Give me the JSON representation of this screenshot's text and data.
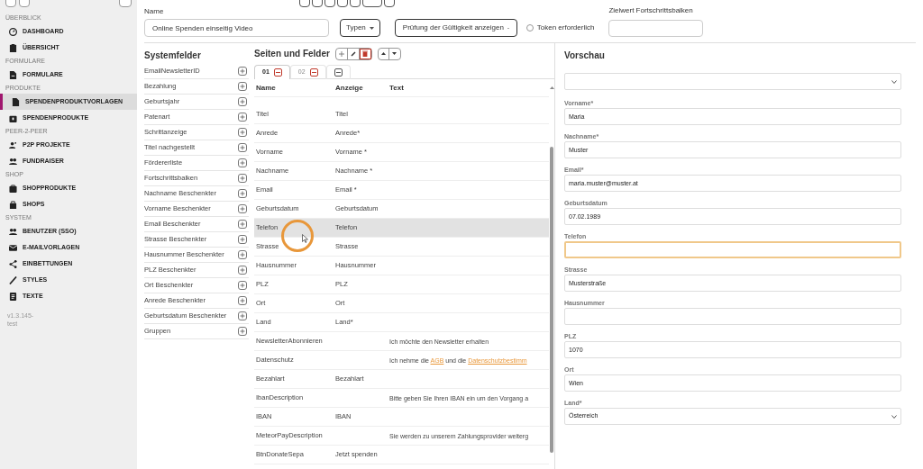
{
  "sidebar": {
    "sections": [
      {
        "title": "ÜBERBLICK",
        "items": [
          {
            "label": "DASHBOARD",
            "selected": false
          },
          {
            "label": "ÜBERSICHT",
            "selected": false
          }
        ]
      },
      {
        "title": "FORMULARE",
        "items": [
          {
            "label": "FORMULARE",
            "selected": false
          }
        ]
      },
      {
        "title": "PRODUKTE",
        "items": [
          {
            "label": "SPENDENPRODUKTVORLAGEN",
            "selected": true
          },
          {
            "label": "SPENDENPRODUKTE",
            "selected": false
          }
        ]
      },
      {
        "title": "PEER-2-PEER",
        "items": [
          {
            "label": "P2P PROJEKTE",
            "selected": false
          },
          {
            "label": "FUNDRAISER",
            "selected": false
          }
        ]
      },
      {
        "title": "SHOP",
        "items": [
          {
            "label": "SHOPPRODUKTE",
            "selected": false
          },
          {
            "label": "SHOPS",
            "selected": false
          }
        ]
      },
      {
        "title": "SYSTEM",
        "items": [
          {
            "label": "BENUTZER (SSO)",
            "selected": false
          },
          {
            "label": "E-MAILVORLAGEN",
            "selected": false
          },
          {
            "label": "EINBETTUNGEN",
            "selected": false
          },
          {
            "label": "STYLES",
            "selected": false
          },
          {
            "label": "TEXTE",
            "selected": false
          }
        ]
      }
    ],
    "version": "v1.3.145-\ntest"
  },
  "form": {
    "name_label": "Name",
    "name_value": "Online Spenden einseitig Video",
    "types_button": "Typen",
    "validation_dropdown": "Prüfung der Gültigkeit anzeigen",
    "token_checkbox": {
      "label": "Token erforderlich",
      "checked": false
    },
    "goal_label": "Zielwert Fortschrittsbalken"
  },
  "system_fields": {
    "title": "Systemfelder",
    "items": [
      "EmailNewsletterID",
      "Bezahlung",
      "Geburtsjahr",
      "Patenart",
      "Schrittanzeige",
      "Titel nachgestellt",
      "Fördererliste",
      "Fortschrittsbalken",
      "Nachname Beschenkter",
      "Vorname Beschenkter",
      "Email Beschenkter",
      "Strasse Beschenkter",
      "Hausnummer Beschenkter",
      "PLZ Beschenkter",
      "Ort Beschenkter",
      "Anrede Beschenkter",
      "Geburtsdatum Beschenkter",
      "Gruppen"
    ]
  },
  "pages": {
    "title": "Seiten und Felder",
    "tabs": [
      {
        "label": "01",
        "selected": true
      },
      {
        "label": "02",
        "selected": false
      },
      {
        "selected": false
      }
    ],
    "columns": [
      "Name",
      "Anzeige",
      "Text"
    ],
    "rows": [
      {
        "name": "Titel",
        "display": "Titel",
        "selected": false
      },
      {
        "name": "Anrede",
        "display": "Anrede*",
        "selected": false
      },
      {
        "name": "Vorname",
        "display": "Vorname *",
        "selected": false
      },
      {
        "name": "Nachname",
        "display": "Nachname *",
        "selected": false
      },
      {
        "name": "Email",
        "display": "Email *",
        "selected": false
      },
      {
        "name": "Geburtsdatum",
        "display": "Geburtsdatum",
        "selected": false
      },
      {
        "name": "Telefon",
        "display": "Telefon",
        "selected": true
      },
      {
        "name": "Strasse",
        "display": "Strasse",
        "selected": false
      },
      {
        "name": "Hausnummer",
        "display": "Hausnummer",
        "selected": false
      },
      {
        "name": "PLZ",
        "display": "PLZ",
        "selected": false
      },
      {
        "name": "Ort",
        "display": "Ort",
        "selected": false
      },
      {
        "name": "Land",
        "display": "Land*",
        "selected": false
      },
      {
        "name": "NewsletterAbonnieren",
        "text": [
          {
            "text": "Ich möchte den Newsletter erhalten",
            "link": false
          }
        ],
        "selected": false
      },
      {
        "name": "Datenschutz",
        "text": [
          {
            "text": "Ich nehme die ",
            "link": false
          },
          {
            "text": "AGB",
            "link": true
          },
          {
            "text": " und die ",
            "link": false
          },
          {
            "text": "Datenschutzbestimm",
            "link": true
          }
        ],
        "selected": false
      },
      {
        "name": "Bezahlart",
        "display": "Bezahlart",
        "selected": false
      },
      {
        "name": "IbanDescription",
        "text": [
          {
            "text": "Bitte geben Sie Ihren IBAN ein um den Vorgang a",
            "link": false
          }
        ],
        "selected": false
      },
      {
        "name": "IBAN",
        "display": "IBAN",
        "selected": false
      },
      {
        "name": "MeteorPayDescription",
        "text": [
          {
            "text": "Sie werden zu unserem Zahlungsprovider weiterg",
            "link": false
          }
        ],
        "selected": false
      },
      {
        "name": "BtnDonateSepa",
        "display": "Jetzt spenden",
        "selected": false
      }
    ]
  },
  "preview": {
    "title": "Vorschau",
    "fields": [
      {
        "kind": "select",
        "focused": false
      },
      {
        "kind": "input",
        "label": "Vorname*",
        "value": "Maria",
        "focused": false
      },
      {
        "kind": "input",
        "label": "Nachname*",
        "value": "Muster",
        "focused": false
      },
      {
        "kind": "input",
        "label": "Email*",
        "value": "maria.muster@muster.at",
        "focused": false
      },
      {
        "kind": "input",
        "label": "Geburtsdatum",
        "value": "07.02.1989",
        "focused": false
      },
      {
        "kind": "input",
        "label": "Telefon",
        "focused": true
      },
      {
        "kind": "input",
        "label": "Strasse",
        "value": "Musterstraße",
        "focused": false
      },
      {
        "kind": "input",
        "label": "Hausnummer",
        "focused": false
      },
      {
        "kind": "input",
        "label": "PLZ",
        "value": "1070",
        "focused": false
      },
      {
        "kind": "input",
        "label": "Ort",
        "value": "Wien",
        "focused": false
      },
      {
        "kind": "select",
        "label": "Land*",
        "value": "Österreich",
        "focused": false
      }
    ]
  }
}
